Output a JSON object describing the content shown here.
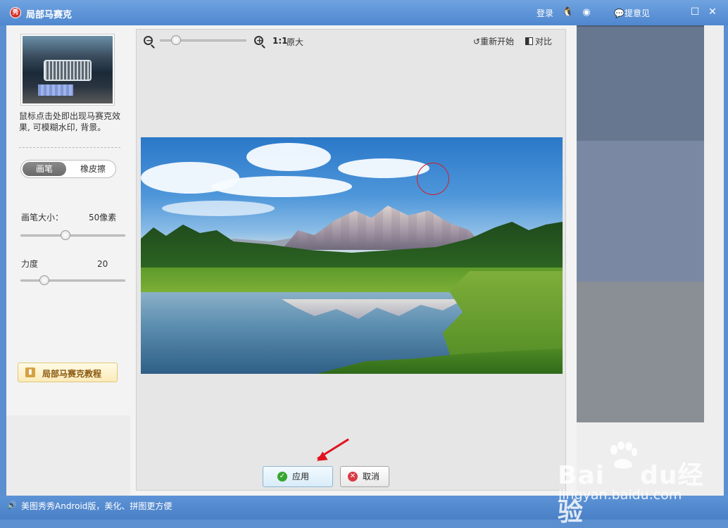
{
  "window": {
    "title": "局部马赛克",
    "logo_text": "秀",
    "login": "登录",
    "feedback": "提意见"
  },
  "left": {
    "description": "鼠标点击处即出现马赛克效果, 可模糊水印, 背景。",
    "mode_tabs": [
      "画笔",
      "橡皮擦"
    ],
    "brush_size_label": "画笔大小：",
    "brush_size_value": "50像素",
    "brush_size_level": 0.42,
    "strength_label": "力度",
    "strength_value": "20",
    "strength_level": 0.2,
    "tutorial_label": "局部马赛克教程"
  },
  "toolbar": {
    "zoom_level": 0.15,
    "one_to_one": "1:1",
    "original_size": "原大",
    "reset": "重新开始",
    "compare": "对比"
  },
  "actions": {
    "apply": "应用",
    "cancel": "取消"
  },
  "status": {
    "text": "美图秀秀Android版，美化、拼图更方便"
  },
  "watermark": {
    "brand": "Bai",
    "brand2": "du",
    "brand_cn": "经验",
    "url": "jingyan.baidu.com"
  },
  "colors": {
    "title_bar": "#5b8fd0",
    "brush_circle": "#d01f2c",
    "apply_icon": "#36a52f",
    "cancel_icon": "#d83a45"
  }
}
